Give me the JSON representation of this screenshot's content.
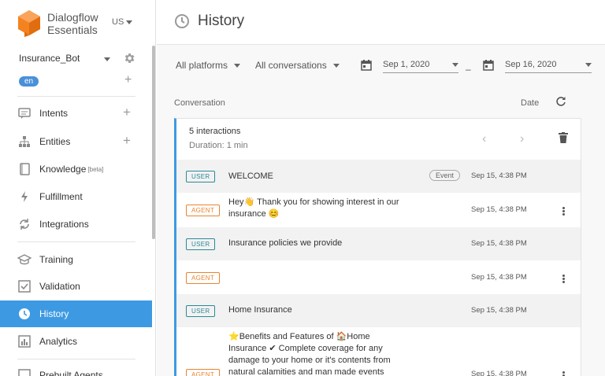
{
  "brand": {
    "line1": "Dialogflow",
    "line2": "Essentials",
    "region": "US"
  },
  "agent": {
    "name": "Insurance_Bot",
    "language": "en"
  },
  "nav": [
    {
      "label": "Intents",
      "icon": "intents-icon",
      "has_add": true
    },
    {
      "label": "Entities",
      "icon": "entities-icon",
      "has_add": true
    },
    {
      "label": "Knowledge",
      "sup": "[beta]",
      "icon": "knowledge-icon",
      "has_add": false
    },
    {
      "label": "Fulfillment",
      "icon": "fulfillment-icon",
      "has_add": false
    },
    {
      "label": "Integrations",
      "icon": "integrations-icon",
      "has_add": false
    },
    {
      "label": "Training",
      "icon": "training-icon",
      "has_add": false
    },
    {
      "label": "Validation",
      "icon": "validation-icon",
      "has_add": false
    },
    {
      "label": "History",
      "icon": "history-icon",
      "has_add": false,
      "active": true
    },
    {
      "label": "Analytics",
      "icon": "analytics-icon",
      "has_add": false
    },
    {
      "label": "Prebuilt Agents",
      "icon": "prebuilt-agents-icon",
      "has_add": false
    }
  ],
  "page": {
    "title": "History"
  },
  "filters": {
    "platform": "All platforms",
    "conversations": "All conversations",
    "date_from": "Sep 1, 2020",
    "date_to": "Sep 16, 2020",
    "separator": "–"
  },
  "list_header": {
    "conversation": "Conversation",
    "date": "Date"
  },
  "conversation": {
    "interactions": "5 interactions",
    "duration": "Duration: 1 min",
    "rows": [
      {
        "role": "USER",
        "text": "WELCOME",
        "chip": "Event",
        "time": "Sep 15, 4:38 PM"
      },
      {
        "role": "AGENT",
        "text": "Hey👋 Thank you for showing interest in our insurance 😊",
        "time": "Sep 15, 4:38 PM"
      },
      {
        "role": "USER",
        "text": "Insurance policies we provide",
        "time": "Sep 15, 4:38 PM"
      },
      {
        "role": "AGENT",
        "text": "",
        "time": "Sep 15, 4:38 PM"
      },
      {
        "role": "USER",
        "text": "Home Insurance",
        "time": "Sep 15, 4:38 PM"
      },
      {
        "role": "AGENT",
        "text": "⭐Benefits and Features of 🏠Home Insurance ✔ Complete coverage for any damage to your home or it's contents from natural calamities and man made events",
        "time": "Sep 15, 4:38 PM"
      }
    ]
  },
  "colors": {
    "accent": "#3d9ae2",
    "user_badge": "#2a8a9a",
    "agent_badge": "#e8842f",
    "logo": "#f58220"
  }
}
